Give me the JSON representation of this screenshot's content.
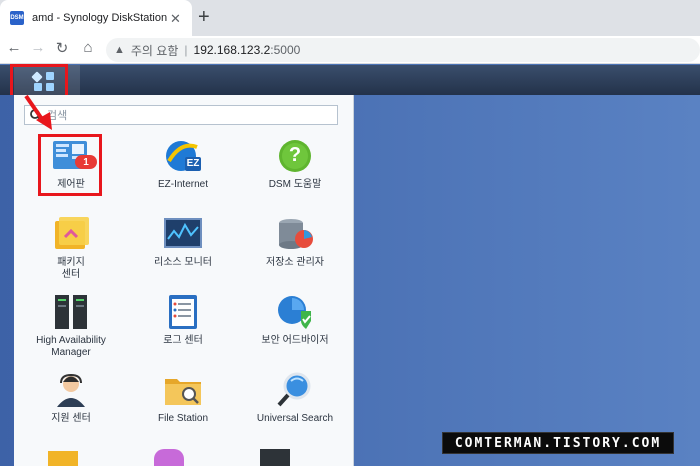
{
  "browser": {
    "tab_title": "amd - Synology DiskStation",
    "favicon_text": "DSM",
    "close_glyph": "✕",
    "new_tab_glyph": "+",
    "back_glyph": "←",
    "forward_glyph": "→",
    "reload_glyph": "↻",
    "home_glyph": "⌂",
    "warning_glyph": "▲",
    "security_label": "주의 요함",
    "separator": "|",
    "url_host": "192.168.123.2",
    "url_port": ":5000"
  },
  "search": {
    "text": "검색"
  },
  "apps": [
    {
      "label": "제어판",
      "badge": "1",
      "icon": "control-panel-icon"
    },
    {
      "label": "EZ-Internet",
      "badge_text": "EZ",
      "icon": "ez-internet-icon"
    },
    {
      "label": "DSM 도움말",
      "glyph": "?",
      "icon": "help-icon"
    },
    {
      "label": "패키지\n센터",
      "icon": "package-center-icon"
    },
    {
      "label": "리소스 모니터",
      "icon": "resource-monitor-icon"
    },
    {
      "label": "저장소 관리자",
      "icon": "storage-manager-icon"
    },
    {
      "label": "High Availability\nManager",
      "icon": "high-availability-icon"
    },
    {
      "label": "로그 센터",
      "icon": "log-center-icon"
    },
    {
      "label": "보안 어드바이저",
      "icon": "security-advisor-icon"
    },
    {
      "label": "지원 센터",
      "icon": "support-center-icon"
    },
    {
      "label": "File Station",
      "icon": "file-station-icon"
    },
    {
      "label": "Universal Search",
      "icon": "universal-search-icon"
    }
  ],
  "watermark": "COMTERMAN.TISTORY.COM",
  "colors": {
    "highlight_red": "#e8161c",
    "dsm_bar": "#2b3a54",
    "desktop_blue": "#4a72b4"
  }
}
